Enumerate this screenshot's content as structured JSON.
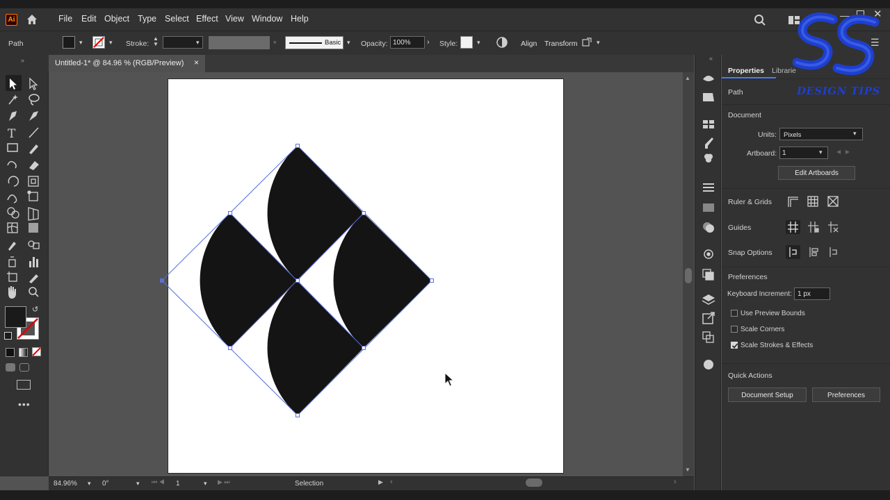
{
  "app": {
    "logo": "Ai"
  },
  "menu": [
    "File",
    "Edit",
    "Object",
    "Type",
    "Select",
    "Effect",
    "View",
    "Window",
    "Help"
  ],
  "control": {
    "object_type": "Path",
    "stroke_label": "Stroke:",
    "brush_label": "Basic",
    "opacity_label": "Opacity:",
    "opacity_value": "100%",
    "style_label": "Style:",
    "align_label": "Align",
    "transform_label": "Transform"
  },
  "document": {
    "tab_title": "Untitled-1* @ 84.96 % (RGB/Preview)",
    "close": "×"
  },
  "status": {
    "zoom": "84.96%",
    "rotation": "0°",
    "artboard": "1",
    "tool": "Selection"
  },
  "properties": {
    "tabs": [
      "Properties",
      "Librarie"
    ],
    "selection_type": "Path",
    "document_heading": "Document",
    "units_label": "Units:",
    "units_value": "Pixels",
    "artboard_label": "Artboard:",
    "artboard_value": "1",
    "edit_artboards": "Edit Artboards",
    "ruler_grids": "Ruler & Grids",
    "guides": "Guides",
    "snap_options": "Snap Options",
    "preferences_heading": "Preferences",
    "keyboard_increment_label": "Keyboard Increment:",
    "keyboard_increment_value": "1 px",
    "use_preview_bounds": "Use Preview Bounds",
    "scale_corners": "Scale Corners",
    "scale_strokes": "Scale Strokes & Effects",
    "quick_actions": "Quick Actions",
    "document_setup": "Document Setup",
    "preferences_button": "Preferences"
  },
  "checkboxes": {
    "use_preview_bounds": false,
    "scale_corners": false,
    "scale_strokes": true
  },
  "watermark": {
    "text": "DESIGN TIPS"
  },
  "colors": {
    "accent": "#4a7cff",
    "selection": "#5b6fd6",
    "shape_fill": "#141414",
    "watermark": "#1d3fd0"
  }
}
